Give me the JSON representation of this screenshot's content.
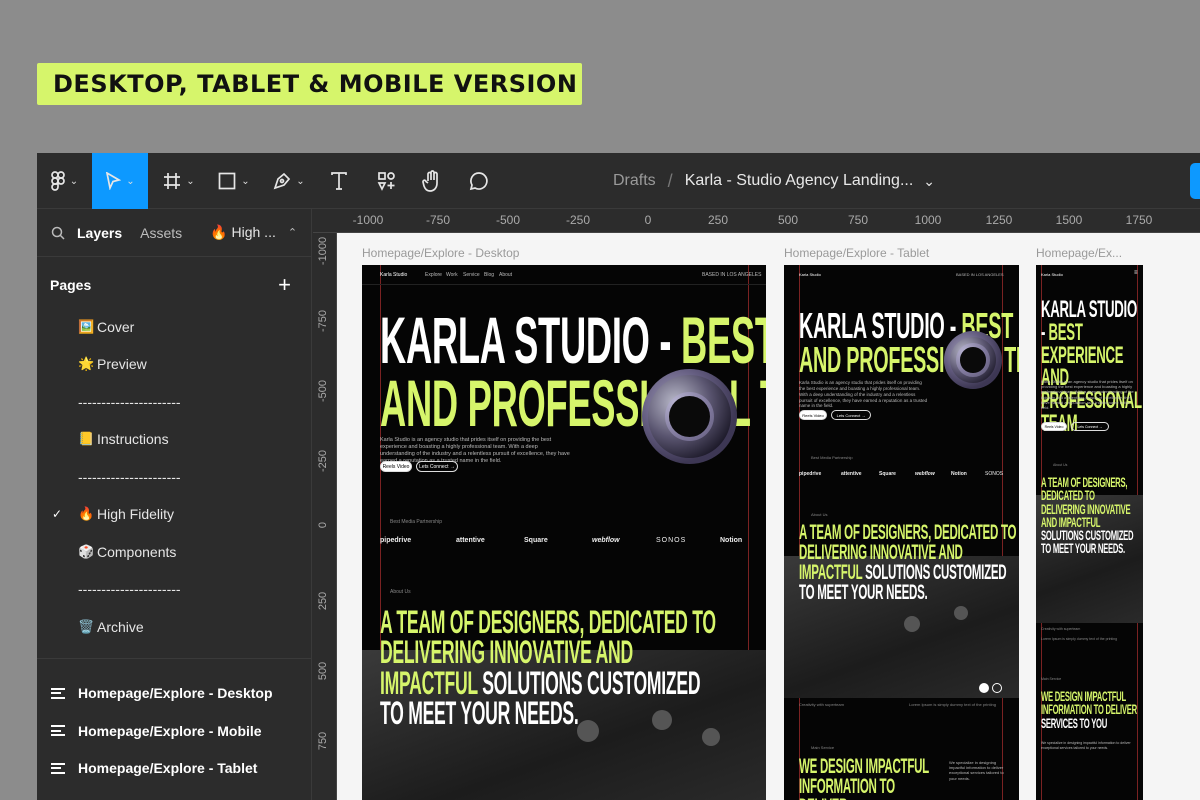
{
  "banner": "DESKTOP, TABLET & MOBILE VERSION",
  "toolbar": {
    "breadcrumb_root": "Drafts",
    "breadcrumb_sep": "/",
    "file_name": "Karla - Studio Agency Landing...",
    "chev": "⌄"
  },
  "sidebar": {
    "tabs": [
      "Layers",
      "Assets",
      "🔥 High ..."
    ],
    "pages_title": "Pages",
    "add": "+",
    "pages": [
      {
        "icon": "🖼️",
        "label": "Cover"
      },
      {
        "icon": "🌟",
        "label": "Preview"
      },
      {
        "icon": "",
        "label": "----------------------"
      },
      {
        "icon": "📒",
        "label": "Instructions"
      },
      {
        "icon": "",
        "label": "----------------------"
      },
      {
        "icon": "🔥",
        "label": "High Fidelity",
        "checked": "✓"
      },
      {
        "icon": "🎲",
        "label": "Components"
      },
      {
        "icon": "",
        "label": "----------------------"
      },
      {
        "icon": "🗑️",
        "label": "Archive"
      }
    ],
    "layers": [
      "Homepage/Explore - Desktop",
      "Homepage/Explore - Mobile",
      "Homepage/Explore - Tablet"
    ]
  },
  "rulers": {
    "top": [
      "-1000",
      "-750",
      "-500",
      "-250",
      "0",
      "250",
      "500",
      "750",
      "1000",
      "1250",
      "1500",
      "1750"
    ],
    "left": [
      "-1000",
      "-750",
      "-500",
      "-250",
      "0",
      "250",
      "500",
      "750"
    ]
  },
  "frames": {
    "desktop_label": "Homepage/Explore - Desktop",
    "tablet_label": "Homepage/Explore - Tablet",
    "mobile_label": "Homepage/Ex...",
    "brand": "Karla Studio",
    "nav": [
      "Explore",
      "Work",
      "Service",
      "Blog",
      "About"
    ],
    "location": "BASED IN LOS ANGELES",
    "hero_white": "KARLA STUDIO -",
    "hero_lime1": "BEST EXPERIENCE",
    "hero_lime2": "AND PROFESSIONAL TEAM",
    "hero_body": "Karla Studio is an agency studio that prides itself on providing the best experience and boasting a highly professional team. With a deep understanding of the industry and a relentless pursuit of excellence, they have earned a reputation as a trusted name in the field.",
    "btn_reels": "Reels Video",
    "btn_connect": "Lets Connect →",
    "partnership": "Best Media Partnership",
    "logos": [
      "pipedrive",
      "attentive",
      "Square",
      "webflow",
      "SONOS",
      "Notion"
    ],
    "about": "About Us",
    "about_lime1": "A TEAM OF DESIGNERS, DEDICATED TO",
    "about_lime2": "DELIVERING INNOVATIVE AND",
    "about_lime3": "IMPACTFUL",
    "about_white3": "SOLUTIONS CUSTOMIZED",
    "about_white4": "TO MEET YOUR NEEDS.",
    "creativity": "Creativity with superteam",
    "lorem": "Lorem Ipsum is simply dummy text of the printing",
    "main_service": "Main Service",
    "service_lime": "WE DESIGN IMPACTFUL INFORMATION TO DELIVER",
    "service_white": "SERVICES TO YOU",
    "service_body": "We specialize in designing impactful information to deliver exceptional services tailored to your needs."
  }
}
